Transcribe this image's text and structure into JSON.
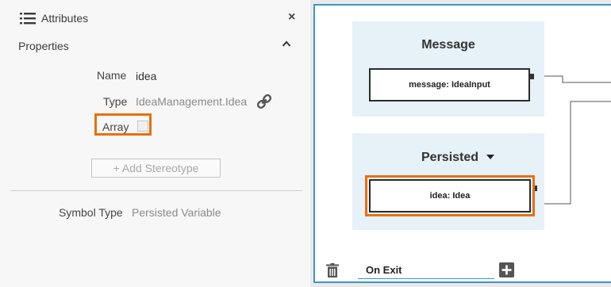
{
  "panel": {
    "title": "Attributes",
    "close_label": "×",
    "section_title": "Properties"
  },
  "properties": {
    "name_label": "Name",
    "name_value": "idea",
    "type_label": "Type",
    "type_value": "IdeaManagement.Idea",
    "array_label": "Array",
    "array_checked": false,
    "add_stereotype_label": "+ Add Stereotype",
    "symbol_type_label": "Symbol Type",
    "symbol_type_value": "Persisted Variable"
  },
  "diagram": {
    "message_lane": {
      "title": "Message",
      "node_label": "message: IdeaInput"
    },
    "persisted_lane": {
      "title": "Persisted",
      "node_label": "idea: Idea"
    },
    "footer": {
      "event_value": "On Exit"
    }
  },
  "colors": {
    "highlight": "#e8700e",
    "accent": "#3b96cc",
    "lane_bg": "#e7f1f8"
  },
  "icons": [
    "list-icon",
    "close-icon",
    "chevron-up-icon",
    "link-icon",
    "dropdown-caret-icon",
    "trash-icon",
    "plus-icon"
  ]
}
